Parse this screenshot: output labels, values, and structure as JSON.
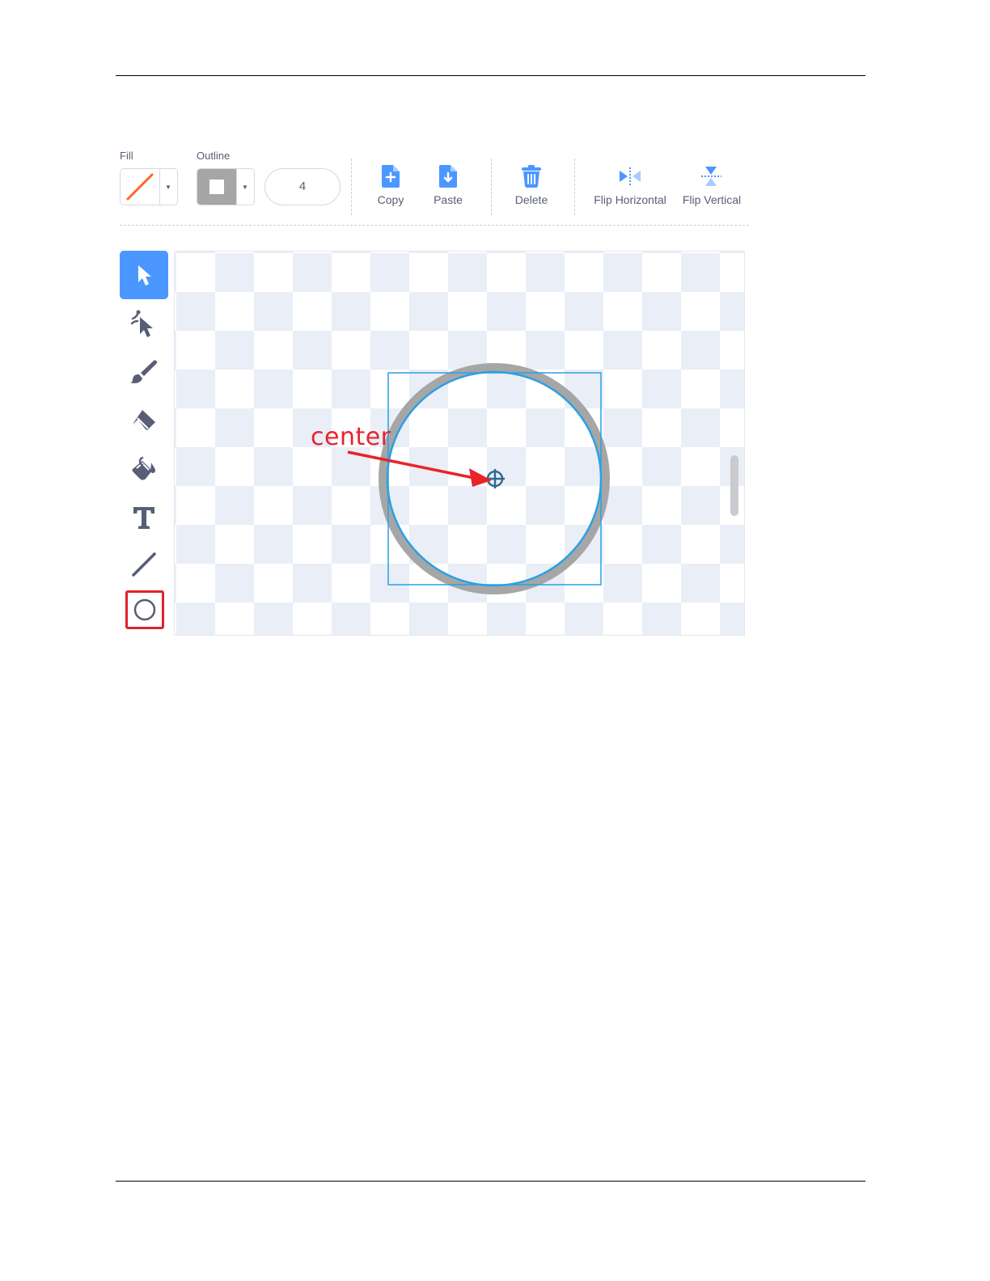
{
  "toolbar": {
    "fill_label": "Fill",
    "outline_label": "Outline",
    "outline_width": "4",
    "fill_color": "#ff661a",
    "outline_color": "#a6a6a6",
    "actions": [
      {
        "label": "Copy",
        "icon": "copy-icon"
      },
      {
        "label": "Paste",
        "icon": "paste-icon"
      },
      {
        "label": "Delete",
        "icon": "trash-icon"
      },
      {
        "label": "Flip Horizontal",
        "icon": "flip-horizontal-icon"
      },
      {
        "label": "Flip Vertical",
        "icon": "flip-vertical-icon"
      }
    ]
  },
  "tools": [
    {
      "name": "select",
      "icon": "arrow-cursor-icon",
      "active": true
    },
    {
      "name": "reshape",
      "icon": "reshape-icon"
    },
    {
      "name": "brush",
      "icon": "brush-icon"
    },
    {
      "name": "eraser",
      "icon": "eraser-icon"
    },
    {
      "name": "fill",
      "icon": "paint-bucket-icon"
    },
    {
      "name": "text",
      "icon": "text-icon"
    },
    {
      "name": "line",
      "icon": "line-icon"
    },
    {
      "name": "circle",
      "icon": "circle-icon",
      "highlighted": true
    }
  ],
  "annotation": {
    "text": "center",
    "color": "#e8232a"
  },
  "colors": {
    "accent": "#4c97ff",
    "selection": "#29a1e4",
    "icon": "#575e75"
  }
}
